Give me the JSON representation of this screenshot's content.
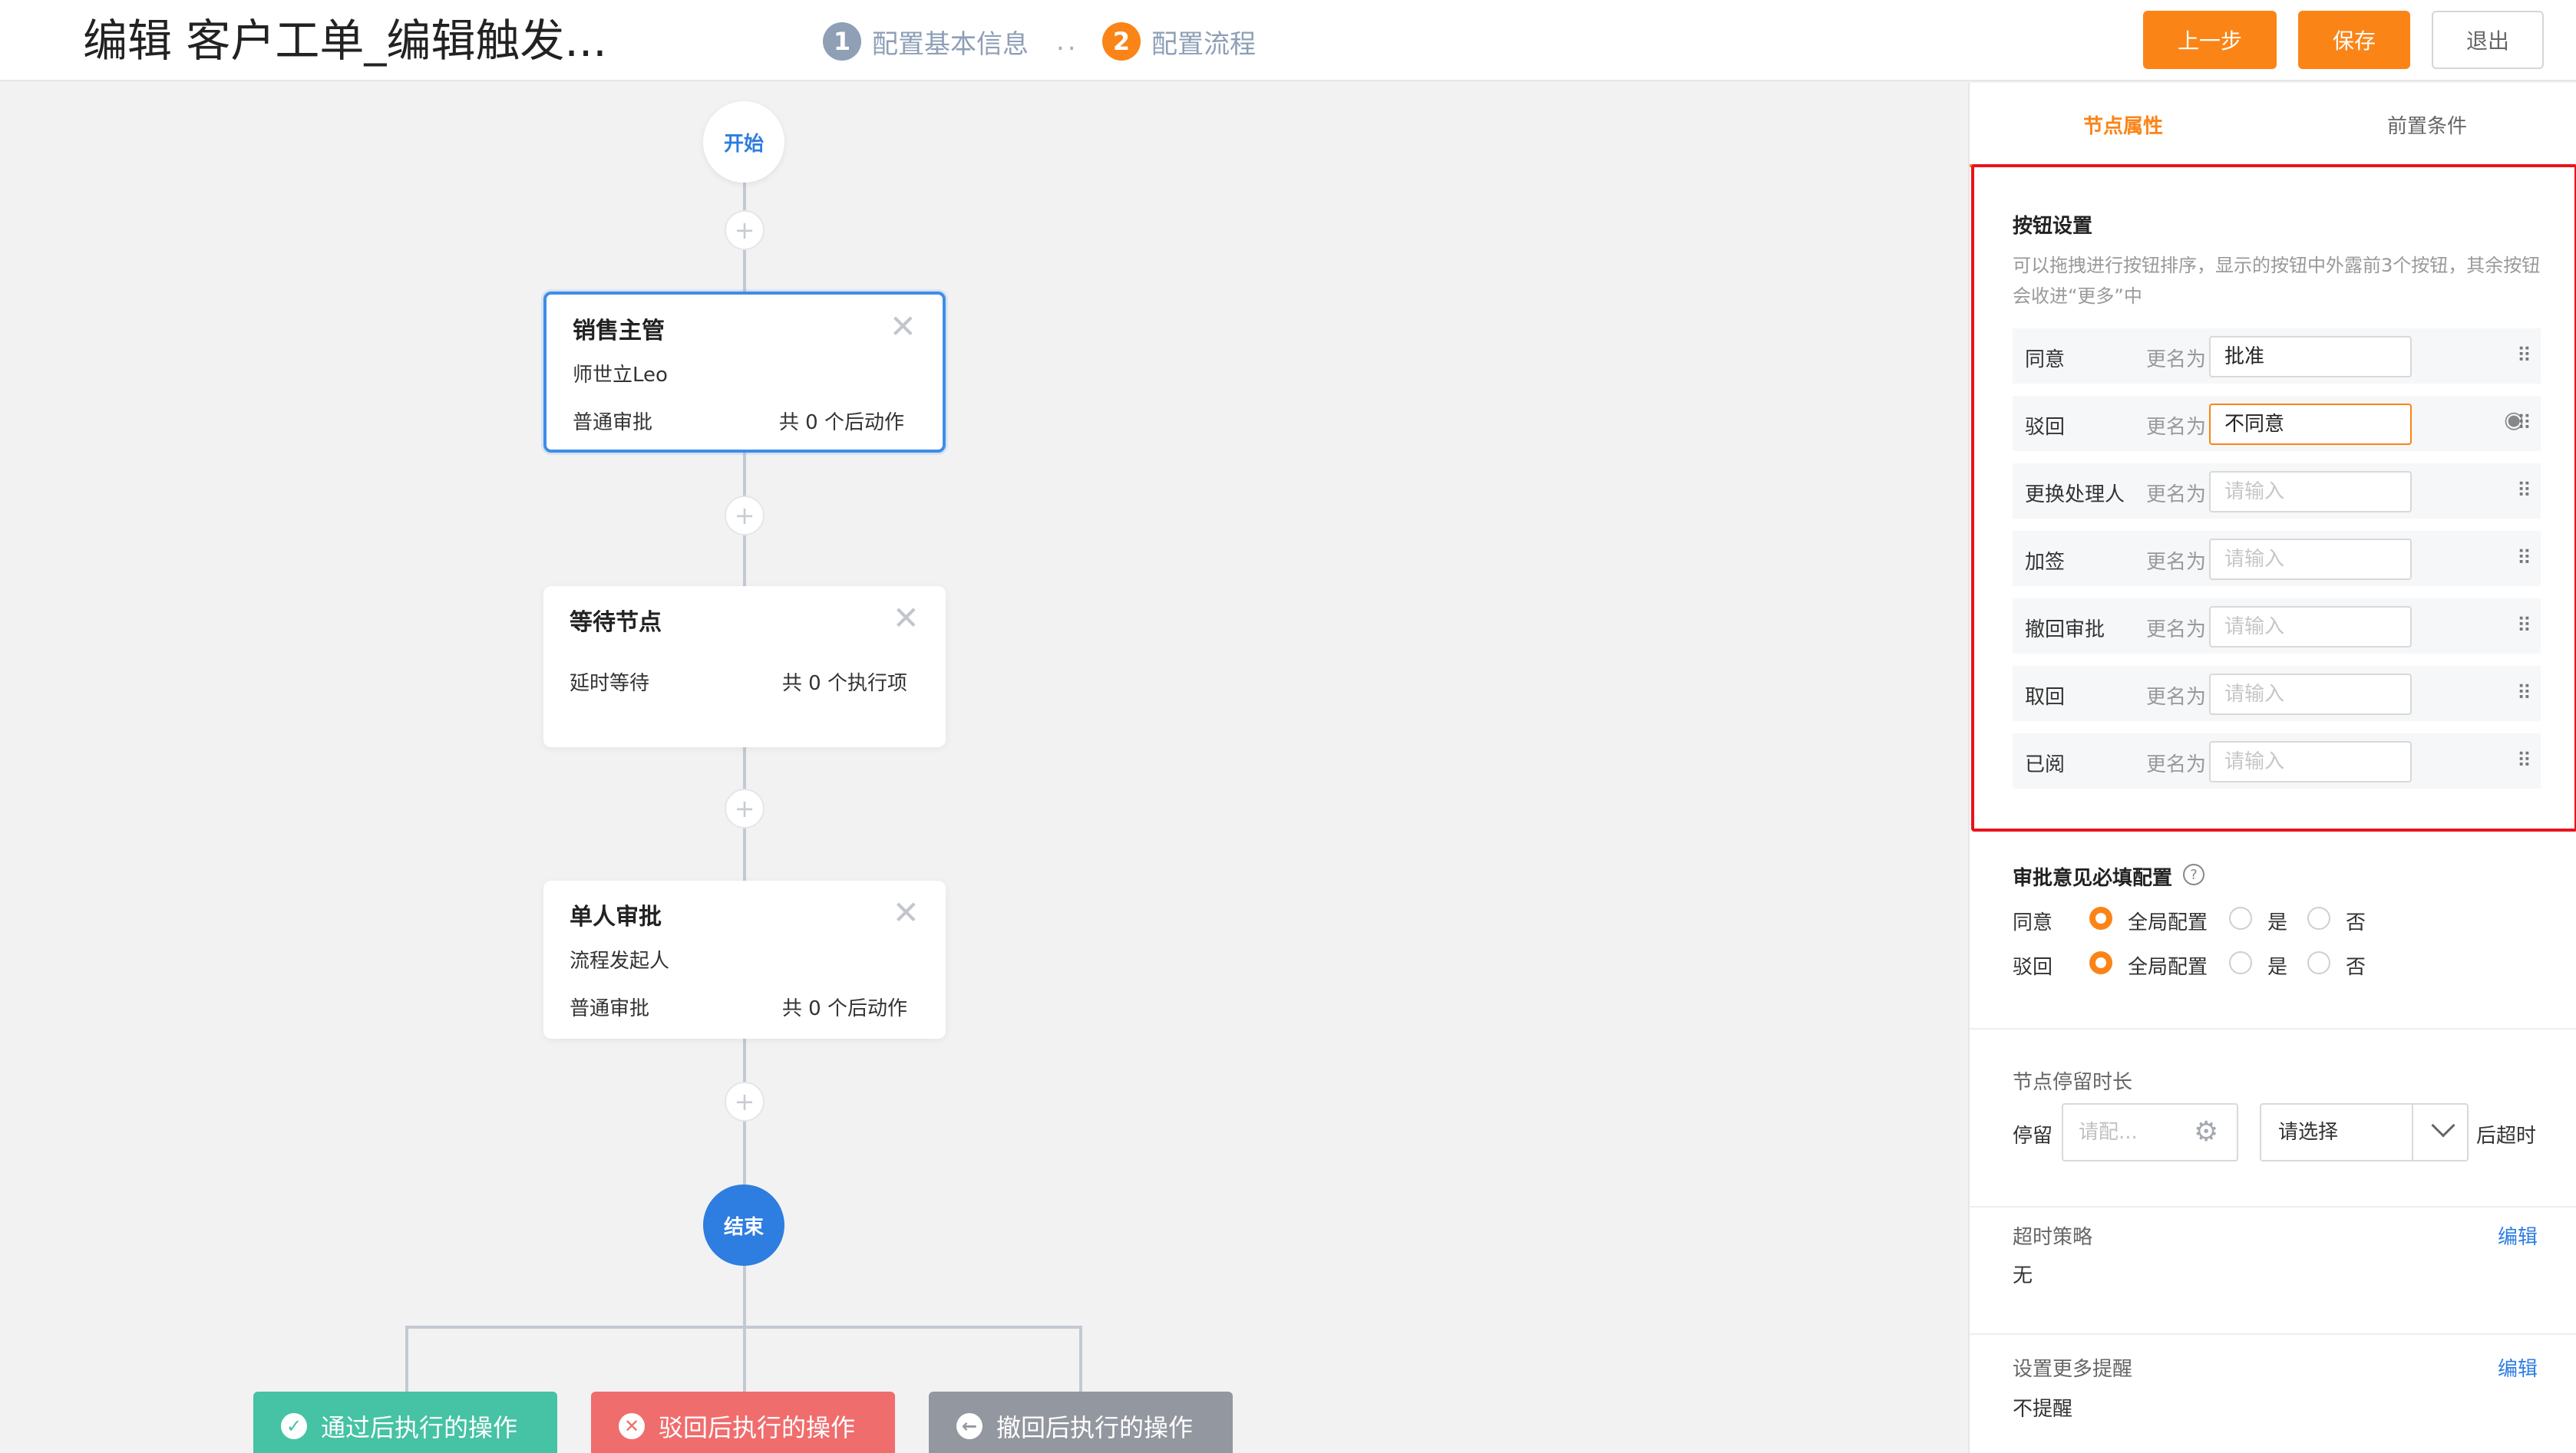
{
  "header": {
    "title": "编辑 客户工单_编辑触发...",
    "steps": [
      {
        "num": "1",
        "label": "配置基本信息"
      },
      {
        "num": "2",
        "label": "配置流程"
      }
    ],
    "step_separator": "..",
    "buttons": {
      "prev": "上一步",
      "save": "保存",
      "exit": "退出"
    }
  },
  "canvas": {
    "start_label": "开始",
    "end_label": "结束",
    "nodes": [
      {
        "title": "销售主管",
        "subtitle": "师世立Leo",
        "left_text": "普通审批",
        "right_text": "共 0 个后动作"
      },
      {
        "title": "等待节点",
        "subtitle": "",
        "left_text": "延时等待",
        "right_text": "共 0 个执行项"
      },
      {
        "title": "单人审批",
        "subtitle": "流程发起人",
        "left_text": "普通审批",
        "right_text": "共 0 个后动作"
      }
    ],
    "actions": {
      "pass": "通过后执行的操作",
      "reject": "驳回后执行的操作",
      "revoke": "撤回后执行的操作"
    }
  },
  "panel": {
    "tabs": {
      "node_props": "节点属性",
      "preconditions": "前置条件"
    },
    "button_settings": {
      "title": "按钮设置",
      "description": "可以拖拽进行按钮排序，显示的按钮中外露前3个按钮，其余按钮会收进“更多”中",
      "rename_label": "更名为",
      "placeholder": "请输入",
      "rows": [
        {
          "name": "同意",
          "value": "批准"
        },
        {
          "name": "驳回",
          "value": "不同意"
        },
        {
          "name": "更换处理人",
          "value": ""
        },
        {
          "name": "加签",
          "value": ""
        },
        {
          "name": "撤回审批",
          "value": ""
        },
        {
          "name": "取回",
          "value": ""
        },
        {
          "name": "已阅",
          "value": ""
        }
      ]
    },
    "opinion": {
      "title": "审批意见必填配置",
      "options": [
        "全局配置",
        "是",
        "否"
      ],
      "rows": [
        {
          "name": "同意",
          "selected": "全局配置"
        },
        {
          "name": "驳回",
          "selected": "全局配置"
        }
      ]
    },
    "stay": {
      "title": "节点停留时长",
      "prefix": "停留",
      "input_placeholder": "请配...",
      "select_value": "请选择",
      "suffix": "后超时"
    },
    "timeout": {
      "title": "超时策略",
      "value": "无",
      "link": "编辑"
    },
    "reminder": {
      "title": "设置更多提醒",
      "value": "不提醒",
      "link": "编辑"
    }
  },
  "colors": {
    "accent": "#fb8417",
    "primary": "#2e7de0",
    "selection_box": "#e8141c",
    "pass": "#45c3a4",
    "reject": "#f06d6d",
    "revoke": "#93979f"
  }
}
